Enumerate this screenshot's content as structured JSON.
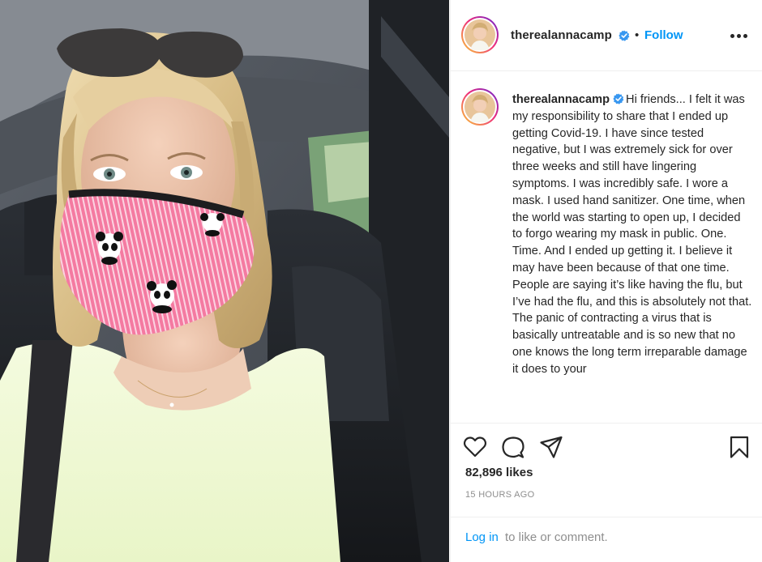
{
  "post": {
    "username": "therealannacamp",
    "follow_separator": "•",
    "follow_label": "Follow",
    "caption": "Hi friends... I felt it was my responsibility to share that I ended up getting Covid-19. I have since tested negative, but I was extremely sick for over three weeks and still have lingering symptoms. I was incredibly safe. I wore a mask. I used hand sanitizer. One time, when the world was starting to open up, I decided to forgo wearing my mask in public. One. Time. And I ended up getting it. I believe it may have been because of that one time. People are saying it’s like having the flu, but I’ve had the flu, and this is absolutely not that. The panic of contracting a virus that is basically untreatable and is so new that no one knows the long term irreparable damage it does to your",
    "likes": "82,896 likes",
    "timestamp": "15 HOURS AGO",
    "login_link": "Log in",
    "login_rest": "to like or comment."
  },
  "icons": {
    "verified": "verified-badge-icon",
    "more": "more-options-icon",
    "like": "heart-icon",
    "comment": "comment-icon",
    "share": "paper-plane-icon",
    "save": "bookmark-icon"
  },
  "colors": {
    "link_blue": "#0095f6",
    "text": "#262626",
    "muted": "#8e8e8e",
    "divider": "#efefef"
  }
}
